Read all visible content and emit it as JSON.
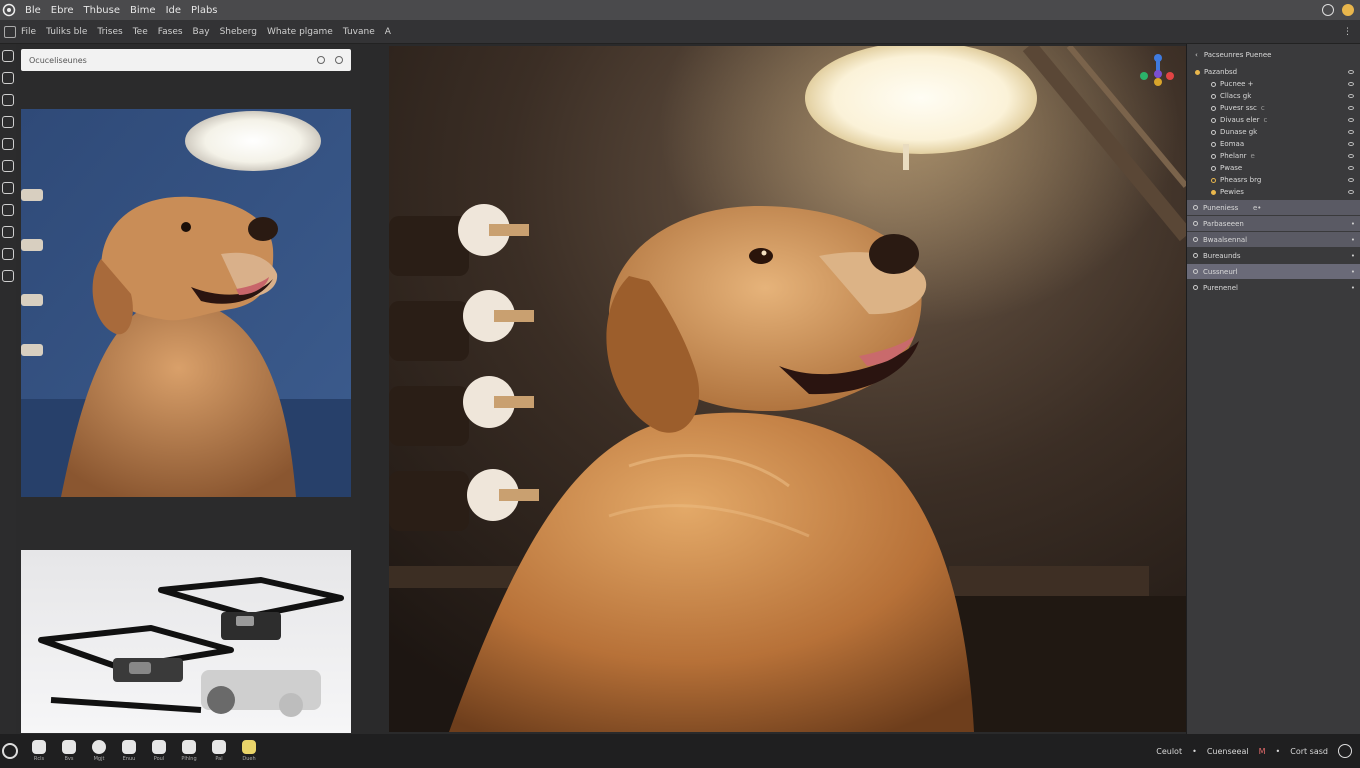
{
  "menubar": {
    "logo_icon": "app-logo-icon",
    "items": [
      "Ble",
      "Ebre",
      "Thbuse",
      "Bime",
      "Ide",
      "Plabs"
    ],
    "right_icons": [
      "update-icon",
      "notification-icon"
    ]
  },
  "toolbar": {
    "items": [
      "File",
      "Tuliks ble",
      "Trises",
      "Tee",
      "Fases",
      "Bay",
      "Sheberg",
      "Whate plgame",
      "Tuvane",
      "A"
    ]
  },
  "reference_panel": {
    "search_placeholder": "Ocuceliseunes",
    "thumb1_desc": "Golden retriever under lamp",
    "thumb2_desc": "Camera rig"
  },
  "outliner": {
    "header": "Pacseunres Puenee",
    "items": [
      {
        "label": "Pazanbsd",
        "extra": ""
      },
      {
        "label": "Pucnee +",
        "extra": ""
      },
      {
        "label": "Cllacs gk",
        "extra": ""
      },
      {
        "label": "Puvesr ssc",
        "extra": "c"
      },
      {
        "label": "Divaus eler",
        "extra": "c"
      },
      {
        "label": "Dunase gk",
        "extra": ""
      },
      {
        "label": "Eomaa",
        "extra": ""
      },
      {
        "label": "Phelanr",
        "extra": "e"
      },
      {
        "label": "Pwase",
        "extra": ""
      },
      {
        "label": "Pheasrs brg",
        "extra": ""
      },
      {
        "label": "Pewies",
        "extra": ""
      }
    ]
  },
  "layers": [
    {
      "label": "Puneniess",
      "suffix": "e•",
      "style": "hl"
    },
    {
      "label": "Parbaseeen",
      "suffix": "•",
      "style": "hl"
    },
    {
      "label": "Bwaalsennal",
      "suffix": "•",
      "style": "hl"
    },
    {
      "label": "Bureaunds",
      "suffix": "•",
      "style": ""
    },
    {
      "label": "Cussneurl",
      "suffix": "•",
      "style": "hl2"
    },
    {
      "label": "Purenenel",
      "suffix": "•",
      "style": ""
    }
  ],
  "bottom_tools": [
    {
      "label": "Rcls",
      "icon": "brush-icon"
    },
    {
      "label": "Bvs",
      "icon": "paw-icon"
    },
    {
      "label": "Mgjt",
      "icon": "heart-icon"
    },
    {
      "label": "Enuu",
      "icon": "camera-icon"
    },
    {
      "label": "Poul",
      "icon": "dog-icon"
    },
    {
      "label": "Plhlng",
      "icon": "cat-icon"
    },
    {
      "label": "Pal",
      "icon": "bottle-icon"
    },
    {
      "label": "Dueh",
      "icon": "grid-icon"
    }
  ],
  "status": {
    "left": "Ceulot",
    "middle": "Cuenseeal",
    "middle_badge": "M",
    "right": "Cort sasd"
  }
}
